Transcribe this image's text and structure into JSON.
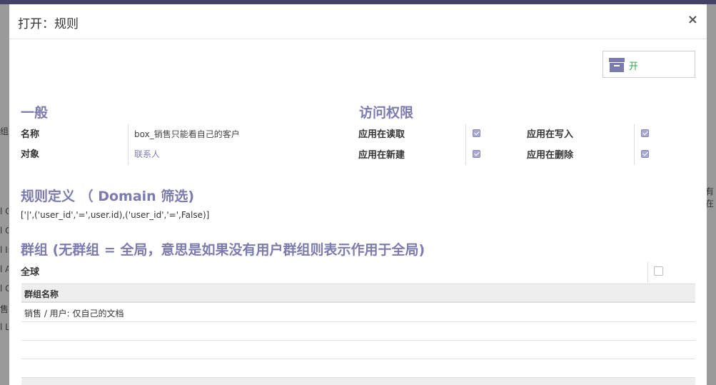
{
  "modal": {
    "title": "打开：规则",
    "close_symbol": "×"
  },
  "status_button": {
    "label": "开",
    "icon": "archive-icon"
  },
  "general": {
    "title": "一般",
    "name_label": "名称",
    "name_value": "box_销售只能看自己的客户",
    "object_label": "对象",
    "object_value": "联系人"
  },
  "access": {
    "title": "访问权限",
    "read_label": "应用在读取",
    "write_label": "应用在写入",
    "create_label": "应用在新建",
    "delete_label": "应用在删除",
    "read": true,
    "write": true,
    "create": true,
    "delete": true
  },
  "domain": {
    "title": "规则定义 （ Domain 筛选)",
    "value": "['|',('user_id','=',user.id),('user_id','=',False)]"
  },
  "groups": {
    "title": "群组 (无群组 = 全局，意思是如果没有用户群组则表示作用于全局)",
    "global_label": "全球",
    "global": false,
    "column_header": "群组名称",
    "rows": [
      "销售 / 用户: 仅自己的文档",
      "",
      ""
    ]
  },
  "background": {
    "right_label": "有在",
    "left_rows": [
      "l C",
      "l C",
      "l In",
      "l A",
      "l C",
      "售只",
      "l L"
    ],
    "left_partial_label": "组"
  }
}
